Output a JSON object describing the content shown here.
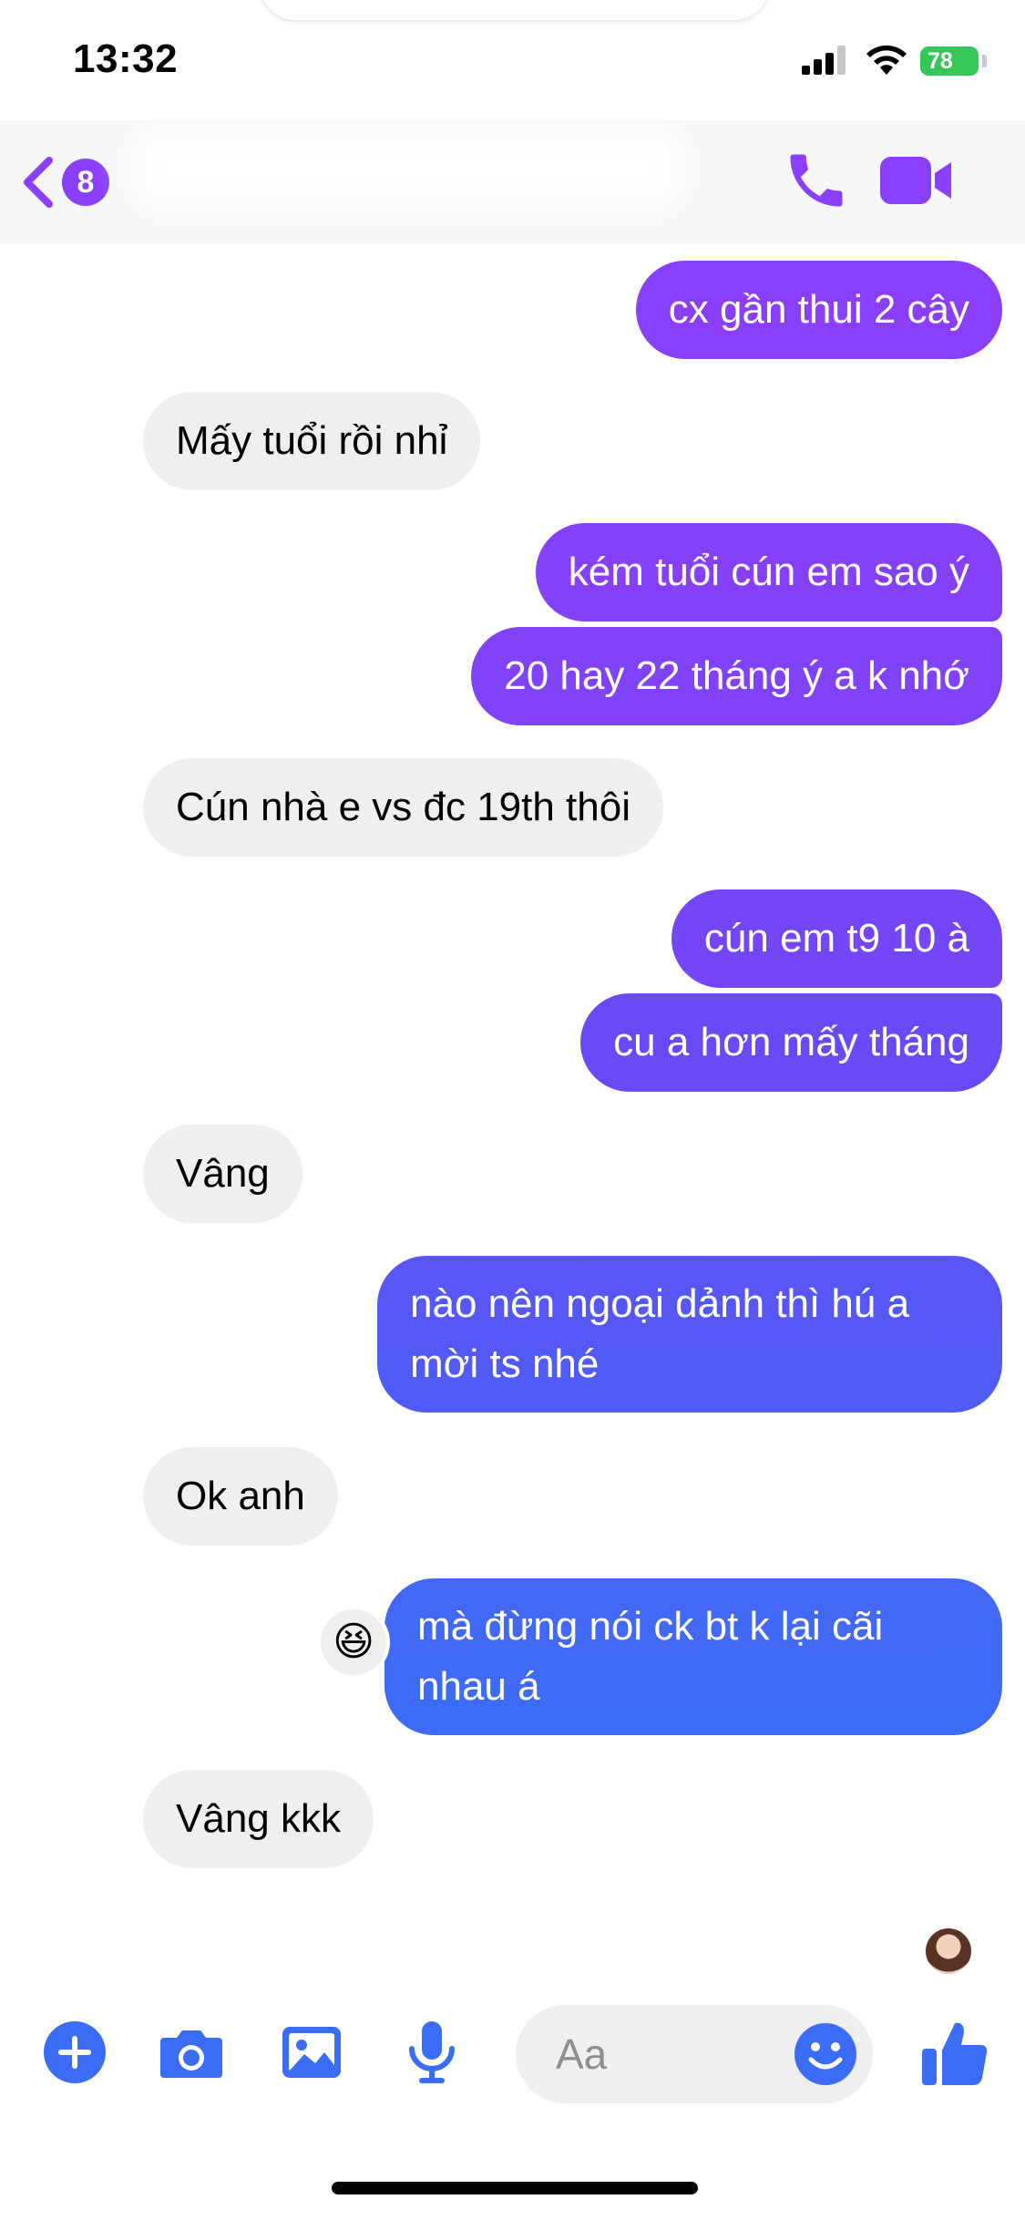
{
  "status": {
    "time": "13:32",
    "battery": "78"
  },
  "header": {
    "unread_count": "8",
    "contact_name": ""
  },
  "messages": [
    {
      "text": "cx gần thui 2 cây",
      "direction": "outgoing"
    },
    {
      "text": "Mấy tuổi rồi nhỉ",
      "direction": "incoming"
    },
    {
      "text": "kém tuổi cún em sao ý",
      "direction": "outgoing"
    },
    {
      "text": "20 hay 22 tháng ý a k nhớ",
      "direction": "outgoing"
    },
    {
      "text": "Cún nhà e vs đc 19th thôi",
      "direction": "incoming"
    },
    {
      "text": "cún em t9 10 à",
      "direction": "outgoing"
    },
    {
      "text": "cu a hơn mấy tháng",
      "direction": "outgoing"
    },
    {
      "text": "Vâng",
      "direction": "incoming"
    },
    {
      "text": "nào nên ngoại dảnh thì hú a mời ts nhé",
      "direction": "outgoing"
    },
    {
      "text": "Ok anh",
      "direction": "incoming"
    },
    {
      "text": "mà đừng nói ck bt k lại cãi nhau á",
      "direction": "outgoing"
    },
    {
      "text": "Vâng kkk",
      "direction": "incoming",
      "reaction": "😆"
    }
  ],
  "composer": {
    "placeholder": "Aa"
  },
  "colors": {
    "accent_top": "#8a3ffc",
    "accent_bottom": "#3b6cf6",
    "incoming_bg": "#efeff0"
  },
  "icons": [
    "plus-circle-icon",
    "camera-icon",
    "photo-icon",
    "microphone-icon",
    "smile-icon",
    "thumbs-up-icon",
    "phone-icon",
    "video-camera-icon",
    "back-chevron-icon"
  ]
}
